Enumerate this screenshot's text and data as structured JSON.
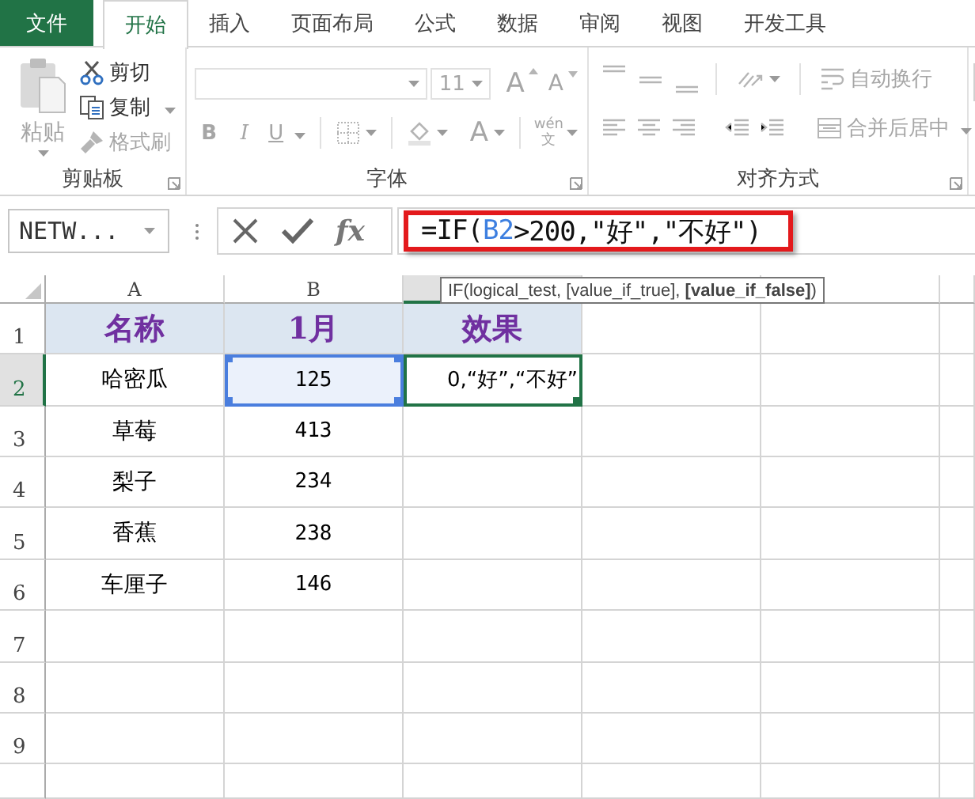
{
  "tabs": [
    {
      "label": "文件",
      "kind": "file",
      "selected": false
    },
    {
      "label": "开始",
      "kind": "tab",
      "selected": true
    },
    {
      "label": "插入",
      "kind": "tab",
      "selected": false
    },
    {
      "label": "页面布局",
      "kind": "tab",
      "selected": false
    },
    {
      "label": "公式",
      "kind": "tab",
      "selected": false
    },
    {
      "label": "数据",
      "kind": "tab",
      "selected": false
    },
    {
      "label": "审阅",
      "kind": "tab",
      "selected": false
    },
    {
      "label": "视图",
      "kind": "tab",
      "selected": false
    },
    {
      "label": "开发工具",
      "kind": "tab",
      "selected": false
    }
  ],
  "ribbon": {
    "disabled": true,
    "groups": [
      {
        "kind": "clipboard",
        "label": "剪贴板",
        "paste": "粘贴",
        "cut": "剪切",
        "copy": "复制",
        "format_painter": "格式刷"
      },
      {
        "kind": "font",
        "label": "字体",
        "size": "11",
        "grow": "A",
        "shrink": "A",
        "bold": "B",
        "italic": "I",
        "underline": "U",
        "font_color": "A",
        "phonetic_top": "wén",
        "phonetic_bottom": "文"
      },
      {
        "kind": "alignment",
        "label": "对齐方式",
        "wrap": "自动换行",
        "merge": "合并后居中"
      }
    ]
  },
  "name_box": {
    "value": "NETW..."
  },
  "function_button": "fx",
  "formula": {
    "highlighted": true,
    "parts": [
      {
        "text": "=IF(",
        "kind": "plain"
      },
      {
        "text": "B2",
        "kind": "ref"
      },
      {
        "text": ">200,\"好\",\"不好\")",
        "kind": "plain"
      }
    ]
  },
  "tooltip": "IF(logical_test, [value_if_true], **[value_if_false]**)",
  "columns": [
    {
      "label": "A",
      "selected": false
    },
    {
      "label": "B",
      "selected": false
    },
    {
      "selected": true
    },
    {
      "selected": false
    },
    {
      "selected": false
    },
    {
      "selected": false
    }
  ],
  "rows": [
    {
      "number": "1",
      "selected": false,
      "cells": [
        {
          "text": "名称",
          "kind": "header",
          "referenced": false,
          "active": false
        },
        {
          "text": "1月",
          "kind": "header",
          "referenced": false,
          "active": false
        },
        {
          "text": "效果",
          "kind": "header",
          "referenced": false,
          "active": false
        }
      ]
    },
    {
      "number": "2",
      "selected": true,
      "cells": [
        {
          "text": "哈密瓜",
          "kind": "text",
          "referenced": false,
          "active": false
        },
        {
          "text": "125",
          "kind": "number",
          "referenced": true,
          "active": false
        },
        {
          "text": "0,“好”,“不好”",
          "kind": "editing",
          "referenced": false,
          "active": true
        }
      ]
    },
    {
      "number": "3",
      "selected": false,
      "cells": [
        {
          "text": "草莓",
          "kind": "text",
          "referenced": false,
          "active": false
        },
        {
          "text": "413",
          "kind": "number",
          "referenced": false,
          "active": false
        }
      ]
    },
    {
      "number": "4",
      "selected": false,
      "cells": [
        {
          "text": "梨子",
          "kind": "text",
          "referenced": false,
          "active": false
        },
        {
          "text": "234",
          "kind": "number",
          "referenced": false,
          "active": false
        }
      ]
    },
    {
      "number": "5",
      "selected": false,
      "cells": [
        {
          "text": "香蕉",
          "kind": "text",
          "referenced": false,
          "active": false
        },
        {
          "text": "238",
          "kind": "number",
          "referenced": false,
          "active": false
        }
      ]
    },
    {
      "number": "6",
      "selected": false,
      "cells": [
        {
          "text": "车厘子",
          "kind": "text",
          "referenced": false,
          "active": false
        },
        {
          "text": "146",
          "kind": "number",
          "referenced": false,
          "active": false
        }
      ]
    },
    {
      "number": "7",
      "selected": false
    },
    {
      "number": "8",
      "selected": false
    },
    {
      "number": "9",
      "selected": false
    },
    {
      "selected": false
    }
  ]
}
